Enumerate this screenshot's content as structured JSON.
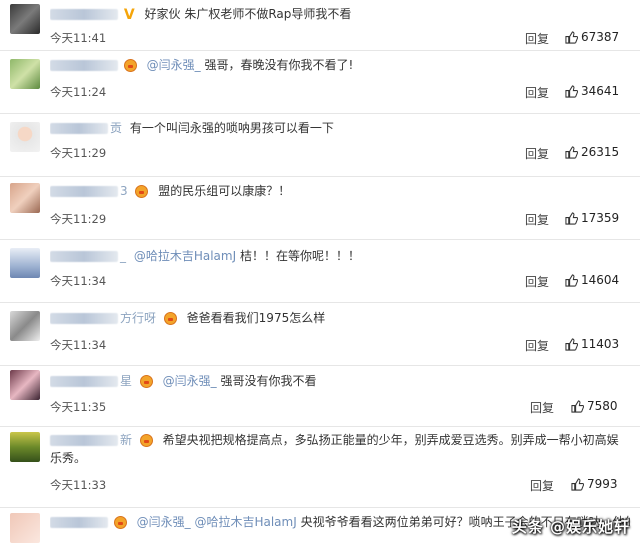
{
  "comments": [
    {
      "nick_tail": "",
      "text_prefix": "",
      "text": "好家伙 朱广权老师不做Rap导师我不看",
      "time": "今天11:41",
      "reply": "回复",
      "likes": "67387",
      "badge": "V"
    },
    {
      "nick_tail": "",
      "text_prefix": "@闫永强_",
      "text": "强哥，春晚没有你我不看了!",
      "time": "今天11:24",
      "reply": "回复",
      "likes": "34641"
    },
    {
      "nick_tail": "贡",
      "text_prefix": "",
      "text": "有一个叫闫永强的唢呐男孩可以看一下",
      "time": "今天11:29",
      "reply": "回复",
      "likes": "26315"
    },
    {
      "nick_tail": "3",
      "text_prefix": "",
      "text": "盟的民乐组可以康康？！",
      "time": "今天11:29",
      "reply": "回复",
      "likes": "17359"
    },
    {
      "nick_tail": "_",
      "text_prefix": "@哈拉木吉HalamJ",
      "text": "桔！！在等你呢！！！",
      "time": "今天11:34",
      "reply": "回复",
      "likes": "14604"
    },
    {
      "nick_tail": "方行呀",
      "text_prefix": "",
      "text": "爸爸看看我们1975怎么样",
      "time": "今天11:34",
      "reply": "回复",
      "likes": "11403"
    },
    {
      "nick_tail": "星",
      "text_prefix": "@闫永强_",
      "text": "强哥没有你我不看",
      "time": "今天11:35",
      "reply": "回复",
      "likes": "7580"
    },
    {
      "nick_tail": "新",
      "text_prefix": "",
      "text": "希望央视把规格提高点，多弘扬正能量的少年，别弄成爱豆选秀。别弄成一帮小初高娱乐秀。",
      "time": "今天11:33",
      "reply": "回复",
      "likes": "7993"
    },
    {
      "nick_tail": "",
      "text_prefix": "@闫永强_ @哈拉木吉HalamJ",
      "text": "央视爷爷看看这两位弟弟可好？唢呐王子会的不只有唢呐，他的",
      "time": "",
      "reply": "",
      "likes": ""
    }
  ],
  "watermark": "头条 @娱乐她轩",
  "colors": {
    "mention": "#6f8eb8",
    "divider": "#e6e6e6",
    "badge": "#f3a42a"
  }
}
